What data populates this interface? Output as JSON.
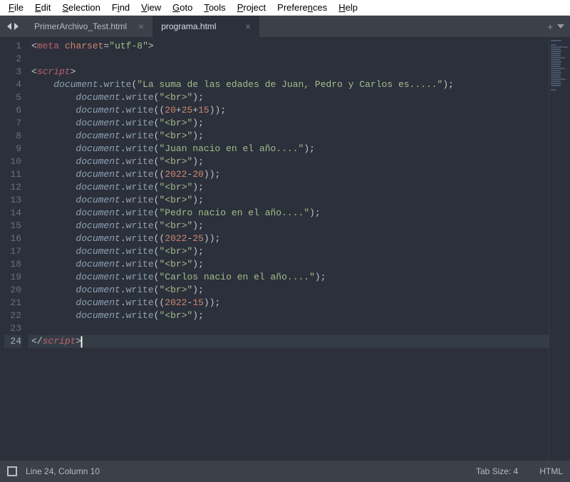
{
  "menu": {
    "items": [
      {
        "plain": "F",
        "u": "",
        "rest": "ile",
        "full": "File"
      },
      {
        "plain": "E",
        "u": "",
        "rest": "dit",
        "full": "Edit"
      },
      {
        "plain": "S",
        "u": "",
        "rest": "election",
        "full": "Selection"
      },
      {
        "plain": "F",
        "u": "",
        "rest": "ind",
        "full": "Find"
      },
      {
        "plain": "V",
        "u": "",
        "rest": "iew",
        "full": "View"
      },
      {
        "plain": "G",
        "u": "",
        "rest": "oto",
        "full": "Goto"
      },
      {
        "plain": "T",
        "u": "",
        "rest": "ools",
        "full": "Tools"
      },
      {
        "plain": "P",
        "u": "",
        "rest": "roject",
        "full": "Project"
      },
      {
        "plain": "P",
        "u": "",
        "rest": "references",
        "full": "Preferences"
      },
      {
        "plain": "H",
        "u": "",
        "rest": "elp",
        "full": "Help"
      }
    ]
  },
  "tabs": {
    "inactive": "PrimerArchivo_Test.html",
    "active": "programa.html",
    "close_glyph": "×",
    "add_glyph": "+"
  },
  "status": {
    "position": "Line 24, Column 10",
    "tab_size": "Tab Size: 4",
    "syntax": "HTML"
  },
  "code_lines": [
    {
      "n": 1,
      "ind": 0,
      "html": "<span class='br'>&lt;</span><span class='t'>meta</span> <span class='a'>charset</span><span class='o'>=</span><span class='s'>\"utf-8\"</span><span class='br'>&gt;</span>"
    },
    {
      "n": 2,
      "ind": 0,
      "html": ""
    },
    {
      "n": 3,
      "ind": 0,
      "html": "<span class='br'>&lt;</span><span class='k'>script</span><span class='br'>&gt;</span>"
    },
    {
      "n": 4,
      "ind": 1,
      "html": "<span class='v'>document</span><span class='p'>.</span><span class='m'>write</span><span class='p'>(</span><span class='s'>\"La suma de las edades de Juan, Pedro y Carlos es.....\"</span><span class='p'>);</span>"
    },
    {
      "n": 5,
      "ind": 2,
      "html": "<span class='v'>document</span><span class='p'>.</span><span class='m'>write</span><span class='p'>(</span><span class='s'>\"&lt;br&gt;\"</span><span class='p'>);</span>"
    },
    {
      "n": 6,
      "ind": 2,
      "html": "<span class='v'>document</span><span class='p'>.</span><span class='m'>write</span><span class='p'>((</span><span class='n'>20</span><span class='p'>+</span><span class='n'>25</span><span class='p'>+</span><span class='n'>15</span><span class='p'>));</span>"
    },
    {
      "n": 7,
      "ind": 2,
      "html": "<span class='v'>document</span><span class='p'>.</span><span class='m'>write</span><span class='p'>(</span><span class='s'>\"&lt;br&gt;\"</span><span class='p'>);</span>"
    },
    {
      "n": 8,
      "ind": 2,
      "html": "<span class='v'>document</span><span class='p'>.</span><span class='m'>write</span><span class='p'>(</span><span class='s'>\"&lt;br&gt;\"</span><span class='p'>);</span>"
    },
    {
      "n": 9,
      "ind": 2,
      "html": "<span class='v'>document</span><span class='p'>.</span><span class='m'>write</span><span class='p'>(</span><span class='s'>\"Juan nacio en el año....\"</span><span class='p'>);</span>"
    },
    {
      "n": 10,
      "ind": 2,
      "html": "<span class='v'>document</span><span class='p'>.</span><span class='m'>write</span><span class='p'>(</span><span class='s'>\"&lt;br&gt;\"</span><span class='p'>);</span>"
    },
    {
      "n": 11,
      "ind": 2,
      "html": "<span class='v'>document</span><span class='p'>.</span><span class='m'>write</span><span class='p'>((</span><span class='n'>2022</span><span class='p'>-</span><span class='n'>20</span><span class='p'>));</span>"
    },
    {
      "n": 12,
      "ind": 2,
      "html": "<span class='v'>document</span><span class='p'>.</span><span class='m'>write</span><span class='p'>(</span><span class='s'>\"&lt;br&gt;\"</span><span class='p'>);</span>"
    },
    {
      "n": 13,
      "ind": 2,
      "html": "<span class='v'>document</span><span class='p'>.</span><span class='m'>write</span><span class='p'>(</span><span class='s'>\"&lt;br&gt;\"</span><span class='p'>);</span>"
    },
    {
      "n": 14,
      "ind": 2,
      "html": "<span class='v'>document</span><span class='p'>.</span><span class='m'>write</span><span class='p'>(</span><span class='s'>\"Pedro nacio en el año....\"</span><span class='p'>);</span>"
    },
    {
      "n": 15,
      "ind": 2,
      "html": "<span class='v'>document</span><span class='p'>.</span><span class='m'>write</span><span class='p'>(</span><span class='s'>\"&lt;br&gt;\"</span><span class='p'>);</span>"
    },
    {
      "n": 16,
      "ind": 2,
      "html": "<span class='v'>document</span><span class='p'>.</span><span class='m'>write</span><span class='p'>((</span><span class='n'>2022</span><span class='p'>-</span><span class='n'>25</span><span class='p'>));</span>"
    },
    {
      "n": 17,
      "ind": 2,
      "html": "<span class='v'>document</span><span class='p'>.</span><span class='m'>write</span><span class='p'>(</span><span class='s'>\"&lt;br&gt;\"</span><span class='p'>);</span>"
    },
    {
      "n": 18,
      "ind": 2,
      "html": "<span class='v'>document</span><span class='p'>.</span><span class='m'>write</span><span class='p'>(</span><span class='s'>\"&lt;br&gt;\"</span><span class='p'>);</span>"
    },
    {
      "n": 19,
      "ind": 2,
      "html": "<span class='v'>document</span><span class='p'>.</span><span class='m'>write</span><span class='p'>(</span><span class='s'>\"Carlos nacio en el año....\"</span><span class='p'>);</span>"
    },
    {
      "n": 20,
      "ind": 2,
      "html": "<span class='v'>document</span><span class='p'>.</span><span class='m'>write</span><span class='p'>(</span><span class='s'>\"&lt;br&gt;\"</span><span class='p'>);</span>"
    },
    {
      "n": 21,
      "ind": 2,
      "html": "<span class='v'>document</span><span class='p'>.</span><span class='m'>write</span><span class='p'>((</span><span class='n'>2022</span><span class='p'>-</span><span class='n'>15</span><span class='p'>));</span>"
    },
    {
      "n": 22,
      "ind": 2,
      "html": "<span class='v'>document</span><span class='p'>.</span><span class='m'>write</span><span class='p'>(</span><span class='s'>\"&lt;br&gt;\"</span><span class='p'>);</span>"
    },
    {
      "n": 23,
      "ind": 0,
      "html": ""
    },
    {
      "n": 24,
      "ind": 0,
      "cur": true,
      "html": "<span class='br'>&lt;/</span><span class='k'>script</span><span class='br'>&gt;</span><span class='cursor'></span>"
    }
  ],
  "minimap_widths": [
    60,
    0,
    30,
    95,
    55,
    60,
    55,
    55,
    80,
    55,
    60,
    55,
    55,
    80,
    55,
    60,
    55,
    55,
    85,
    55,
    60,
    55,
    0,
    30
  ]
}
